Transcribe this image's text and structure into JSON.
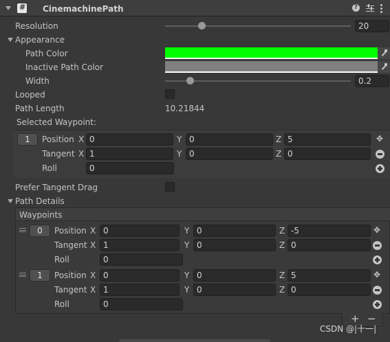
{
  "header": {
    "title": "CinemachinePath",
    "script_glyph": "#",
    "icons": [
      "help-icon",
      "presets-icon",
      "kebab-menu-icon"
    ]
  },
  "resolution": {
    "label": "Resolution",
    "value": "20",
    "slider_fraction": 0.2
  },
  "appearance": {
    "label": "Appearance",
    "path_color": {
      "label": "Path Color",
      "color": "#00ff00"
    },
    "inactive_path_color": {
      "label": "Inactive Path Color",
      "color": "#808080"
    },
    "width": {
      "label": "Width",
      "value": "0.2",
      "slider_fraction": 0.05
    }
  },
  "looped": {
    "label": "Looped",
    "checked": false
  },
  "path_length": {
    "label": "Path Length",
    "value": "10.21844"
  },
  "selected_waypoint": {
    "label": "Selected Waypoint:",
    "index": "1",
    "position": {
      "label": "Position",
      "x": "0",
      "y": "0",
      "z": "5"
    },
    "tangent": {
      "label": "Tangent",
      "x": "1",
      "y": "0",
      "z": "0"
    },
    "roll": {
      "label": "Roll",
      "value": "0"
    }
  },
  "axis_labels": {
    "x": "X",
    "y": "Y",
    "z": "Z"
  },
  "prefer_tangent_drag": {
    "label": "Prefer Tangent Drag",
    "checked": false
  },
  "path_details": {
    "label": "Path Details",
    "waypoints_header": "Waypoints",
    "waypoints": [
      {
        "index": "0",
        "position": {
          "label": "Position",
          "x": "0",
          "y": "0",
          "z": "-5"
        },
        "tangent": {
          "label": "Tangent",
          "x": "1",
          "y": "0",
          "z": "0"
        },
        "roll": {
          "label": "Roll",
          "value": "0"
        }
      },
      {
        "index": "1",
        "position": {
          "label": "Position",
          "x": "0",
          "y": "0",
          "z": "5"
        },
        "tangent": {
          "label": "Tangent",
          "x": "1",
          "y": "0",
          "z": "0"
        },
        "roll": {
          "label": "Roll",
          "value": "0"
        }
      }
    ],
    "add_label": "+",
    "remove_label": "−"
  },
  "watermark": "CSDN @|十一|"
}
